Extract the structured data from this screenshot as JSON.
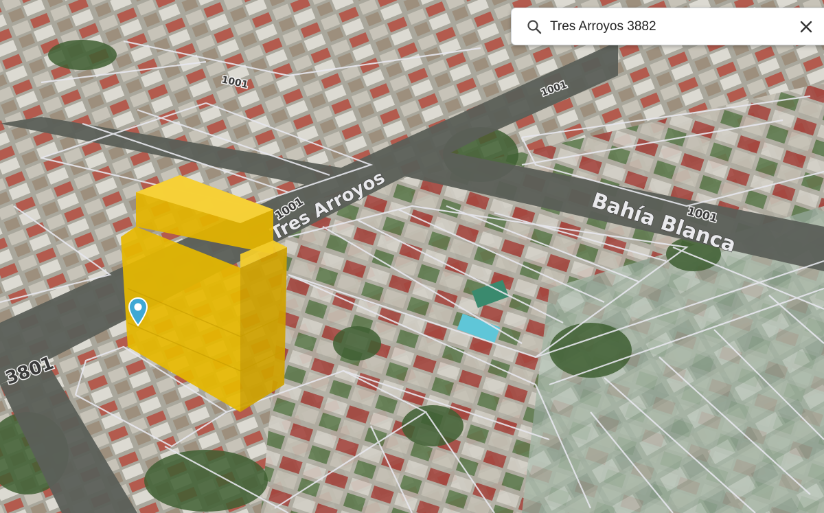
{
  "search": {
    "value": "Tres Arroyos 3882",
    "placeholder": ""
  },
  "icons": {
    "search": "search-icon",
    "close": "close-icon",
    "pin": "map-pin-icon"
  },
  "streets": {
    "tres_arroyos": "Tres Arroyos",
    "bahia_blanca": "Bahía Blanca"
  },
  "block_numbers": {
    "n3801": "3801",
    "n1001_a": "1001",
    "n1001_b": "1001",
    "n1001_c": "1001",
    "n1001_d": "1001"
  },
  "colors": {
    "building_highlight": "#f2c200",
    "pin": "#3fa8d4",
    "parcel_lines": "#e7e7ee"
  }
}
